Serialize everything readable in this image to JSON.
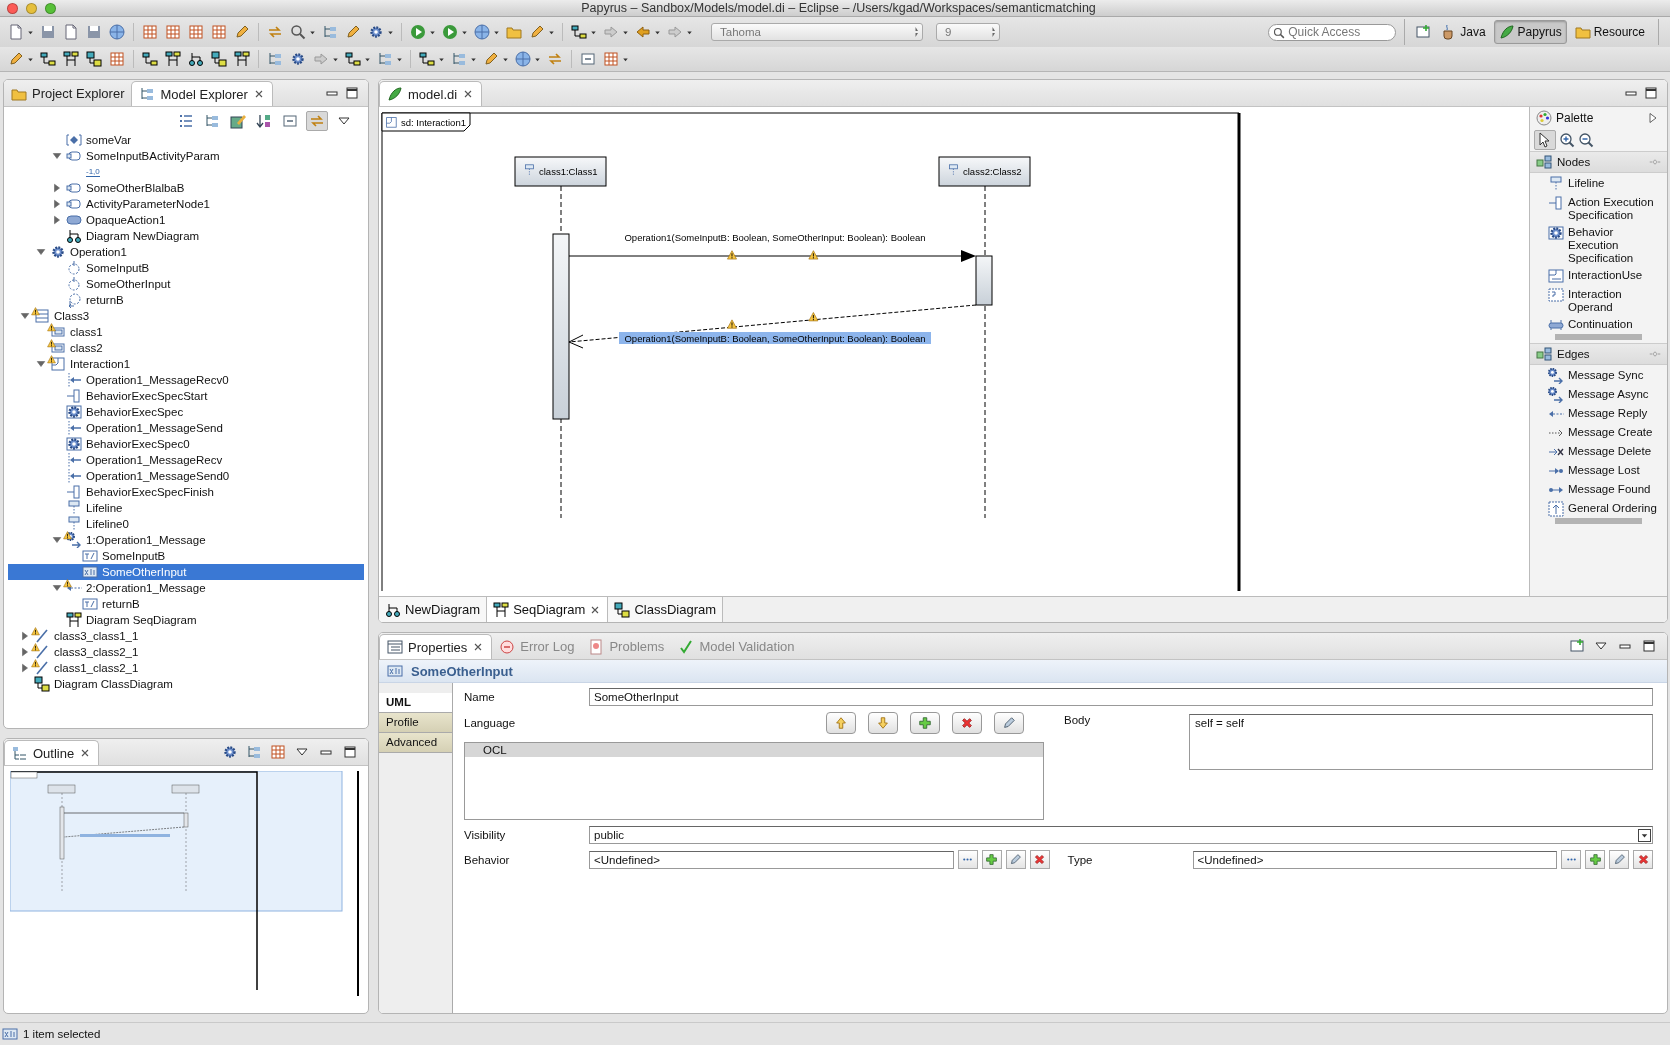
{
  "window": {
    "title": "Papyrus – Sandbox/Models/model.di – Eclipse – /Users/kgad/Workspaces/semanticmatching"
  },
  "toolbar": {
    "font_name": "Tahoma",
    "font_size": "9",
    "quick_access": {
      "placeholder": "Quick Access"
    },
    "perspectives": [
      {
        "label": "Java",
        "kind": "java",
        "selected": false
      },
      {
        "label": "Papyrus",
        "kind": "papyrus",
        "selected": true
      },
      {
        "label": "Resource",
        "kind": "resource",
        "selected": false
      }
    ]
  },
  "explorer": {
    "tabs": [
      {
        "label": "Project Explorer",
        "kind": "project",
        "selected": false
      },
      {
        "label": "Model Explorer",
        "kind": "model",
        "selected": true
      }
    ],
    "tree": [
      {
        "children": [
          {
            "children": [
              {
                "label": "someVar",
                "kind": "variable",
                "selected": false
              },
              {
                "label": "SomeInputBActivityParam",
                "kind": "pin",
                "expanded": true,
                "selected": false,
                "children": [
                  {
                    "label": "-1,0",
                    "kind": "literal",
                    "selected": false
                  }
                ]
              },
              {
                "label": "SomeOtherBlalbaB",
                "kind": "pin",
                "expanded": false,
                "selected": false
              },
              {
                "label": "ActivityParameterNode1",
                "kind": "pin",
                "expanded": false,
                "selected": false
              },
              {
                "label": "OpaqueAction1",
                "kind": "action",
                "expanded": false,
                "selected": false
              },
              {
                "label": "Diagram NewDiagram",
                "kind": "newdiagram",
                "selected": false
              }
            ]
          },
          {
            "label": "Operation1",
            "kind": "operation",
            "expanded": true,
            "selected": false,
            "children": [
              {
                "label": "SomeInputB",
                "kind": "param",
                "selected": false
              },
              {
                "label": "SomeOtherInput",
                "kind": "param",
                "selected": false
              },
              {
                "label": "returnB",
                "kind": "return",
                "selected": false
              }
            ]
          }
        ]
      },
      {
        "label": "Class3",
        "kind": "class",
        "expanded": true,
        "selected": false,
        "warning": true,
        "children": [
          {
            "label": "class1",
            "kind": "property",
            "selected": false,
            "warning": true
          },
          {
            "label": "class2",
            "kind": "property",
            "selected": false,
            "warning": true
          },
          {
            "label": "Interaction1",
            "kind": "interaction",
            "expanded": true,
            "selected": false,
            "warning": true,
            "children": [
              {
                "label": "Operation1_MessageRecv0",
                "kind": "msgend",
                "selected": false
              },
              {
                "label": "BehaviorExecSpecStart",
                "kind": "execstart",
                "selected": false
              },
              {
                "label": "BehaviorExecSpec",
                "kind": "exec",
                "selected": false
              },
              {
                "label": "Operation1_MessageSend",
                "kind": "msgend",
                "selected": false
              },
              {
                "label": "BehaviorExecSpec0",
                "kind": "exec",
                "selected": false
              },
              {
                "label": "Operation1_MessageRecv",
                "kind": "msgend",
                "selected": false
              },
              {
                "label": "Operation1_MessageSend0",
                "kind": "msgend",
                "selected": false
              },
              {
                "label": "BehaviorExecSpecFinish",
                "kind": "execstart",
                "selected": false
              },
              {
                "label": "Lifeline",
                "kind": "lifeline",
                "selected": false
              },
              {
                "label": "Lifeline0",
                "kind": "lifeline",
                "selected": false
              },
              {
                "label": "1:Operation1_Message",
                "kind": "message",
                "expanded": true,
                "selected": false,
                "warning": true,
                "children": [
                  {
                    "label": "SomeInputB",
                    "kind": "boolean",
                    "selected": false
                  },
                  {
                    "label": "SomeOtherInput",
                    "kind": "expression",
                    "selected": true
                  }
                ]
              },
              {
                "label": "2:Operation1_Message",
                "kind": "reply",
                "expanded": true,
                "selected": false,
                "warning": true,
                "children": [
                  {
                    "label": "returnB",
                    "kind": "boolean",
                    "selected": false
                  }
                ]
              },
              {
                "label": "Diagram SeqDiagram",
                "kind": "seqdiagram",
                "selected": false
              }
            ]
          }
        ]
      },
      {
        "label": "class3_class1_1",
        "kind": "association",
        "expanded": false,
        "selected": false,
        "warning": true
      },
      {
        "label": "class3_class2_1",
        "kind": "association",
        "expanded": false,
        "selected": false,
        "warning": true
      },
      {
        "label": "class1_class2_1",
        "kind": "association",
        "expanded": false,
        "selected": false,
        "warning": true
      },
      {
        "label": "Diagram ClassDiagram",
        "kind": "classdiagram",
        "selected": false
      }
    ]
  },
  "outline": {
    "tab": "Outline"
  },
  "editor": {
    "tabs": [
      {
        "label": "model.di",
        "selected": true
      }
    ],
    "diagram": {
      "frame_label": "sd: Interaction1",
      "lifelines": [
        {
          "label": "class1:Class1"
        },
        {
          "label": "class2:Class2"
        }
      ],
      "messages": [
        {
          "label": "Operation1(SomeInputB: Boolean, SomeOtherInput: Boolean): Boolean",
          "kind": "sync",
          "selected": false,
          "warning": true
        },
        {
          "label": "Operation1(SomeInputB: Boolean, SomeOtherInput: Boolean): Boolean",
          "kind": "reply",
          "selected": true,
          "warning": true
        }
      ]
    },
    "palette": {
      "title": "Palette",
      "drawers": [
        {
          "label": "Nodes",
          "items": [
            {
              "label": "Lifeline",
              "kind": "lifeline"
            },
            {
              "label": "Action Execution Specification",
              "kind": "execstart"
            },
            {
              "label": "Behavior Execution Specification",
              "kind": "exec"
            },
            {
              "label": "InteractionUse",
              "kind": "interactionuse"
            },
            {
              "label": "Interaction Operand",
              "kind": "operand"
            },
            {
              "label": "Continuation",
              "kind": "continuation"
            }
          ]
        },
        {
          "label": "Edges",
          "items": [
            {
              "label": "Message Sync",
              "kind": "message"
            },
            {
              "label": "Message Async",
              "kind": "message"
            },
            {
              "label": "Message Reply",
              "kind": "reply"
            },
            {
              "label": "Message Create",
              "kind": "create"
            },
            {
              "label": "Message Delete",
              "kind": "delete"
            },
            {
              "label": "Message Lost",
              "kind": "lost"
            },
            {
              "label": "Message Found",
              "kind": "found"
            },
            {
              "label": "General Ordering",
              "kind": "ordering"
            }
          ]
        }
      ]
    },
    "diagram_tabs": [
      {
        "label": "NewDiagram",
        "kind": "newdiagram",
        "selected": false
      },
      {
        "label": "SeqDiagram",
        "kind": "seqdiagram",
        "selected": true
      },
      {
        "label": "ClassDiagram",
        "kind": "classdiagram",
        "selected": false
      }
    ]
  },
  "properties": {
    "tabs": [
      {
        "label": "Properties",
        "kind": "properties",
        "selected": true
      },
      {
        "label": "Error Log",
        "kind": "errorlog",
        "selected": false
      },
      {
        "label": "Problems",
        "kind": "problems",
        "selected": false
      },
      {
        "label": "Model Validation",
        "kind": "validation",
        "selected": false
      }
    ],
    "title": "SomeOtherInput",
    "side_tabs": [
      {
        "label": "UML",
        "selected": true
      },
      {
        "label": "Profile",
        "selected": false
      },
      {
        "label": "Advanced",
        "selected": false
      }
    ],
    "name": {
      "label": "Name",
      "value": "SomeOtherInput"
    },
    "language": {
      "label": "Language",
      "items": [
        {
          "label": "OCL",
          "selected": true
        }
      ]
    },
    "body": {
      "label": "Body",
      "value": "self = self"
    },
    "visibility": {
      "label": "Visibility",
      "value": "public"
    },
    "behavior": {
      "label": "Behavior",
      "value": "<Undefined>"
    },
    "type": {
      "label": "Type",
      "value": "<Undefined>"
    }
  },
  "status_bar": {
    "text": "1 item selected"
  }
}
